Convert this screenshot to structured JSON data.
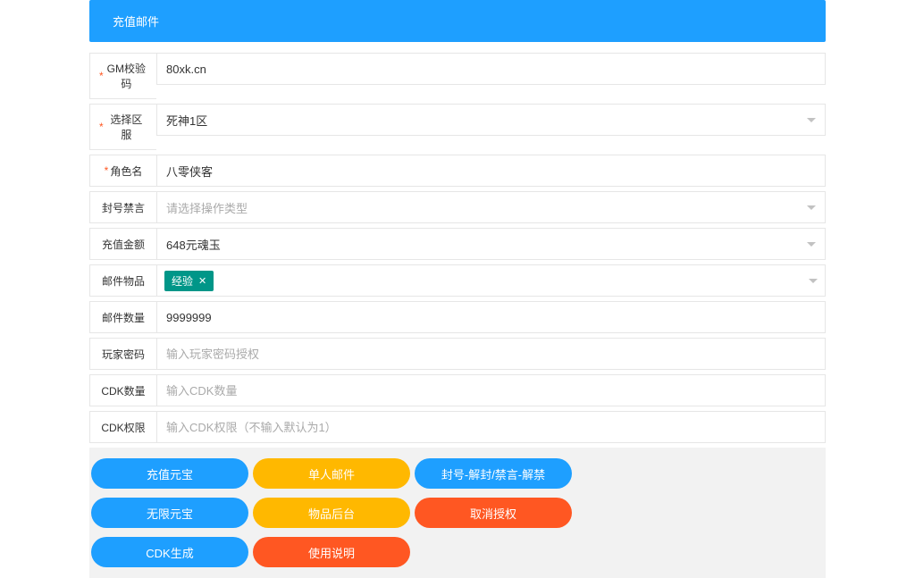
{
  "header": {
    "title": "充值邮件"
  },
  "form": {
    "gm_code": {
      "label": "GM校验码",
      "value": "80xk.cn",
      "required": true
    },
    "server": {
      "label": "选择区服",
      "value": "死神1区",
      "required": true
    },
    "role_name": {
      "label": "角色名",
      "value": "八零侠客",
      "required": true
    },
    "ban": {
      "label": "封号禁言",
      "placeholder": "请选择操作类型"
    },
    "amount": {
      "label": "充值金额",
      "value": "648元魂玉"
    },
    "mail_item": {
      "label": "邮件物品",
      "tag": "经验"
    },
    "mail_count": {
      "label": "邮件数量",
      "value": "9999999"
    },
    "player_pwd": {
      "label": "玩家密码",
      "placeholder": "输入玩家密码授权"
    },
    "cdk_count": {
      "label": "CDK数量",
      "placeholder": "输入CDK数量"
    },
    "cdk_limit": {
      "label": "CDK权限",
      "placeholder": "输入CDK权限（不输入默认为1）"
    }
  },
  "buttons": {
    "row1": {
      "b1": "充值元宝",
      "b2": "单人邮件",
      "b3": "封号-解封/禁言-解禁"
    },
    "row2": {
      "b1": "无限元宝",
      "b2": "物品后台",
      "b3": "取消授权"
    },
    "row3": {
      "b1": "CDK生成",
      "b2": "使用说明"
    }
  }
}
